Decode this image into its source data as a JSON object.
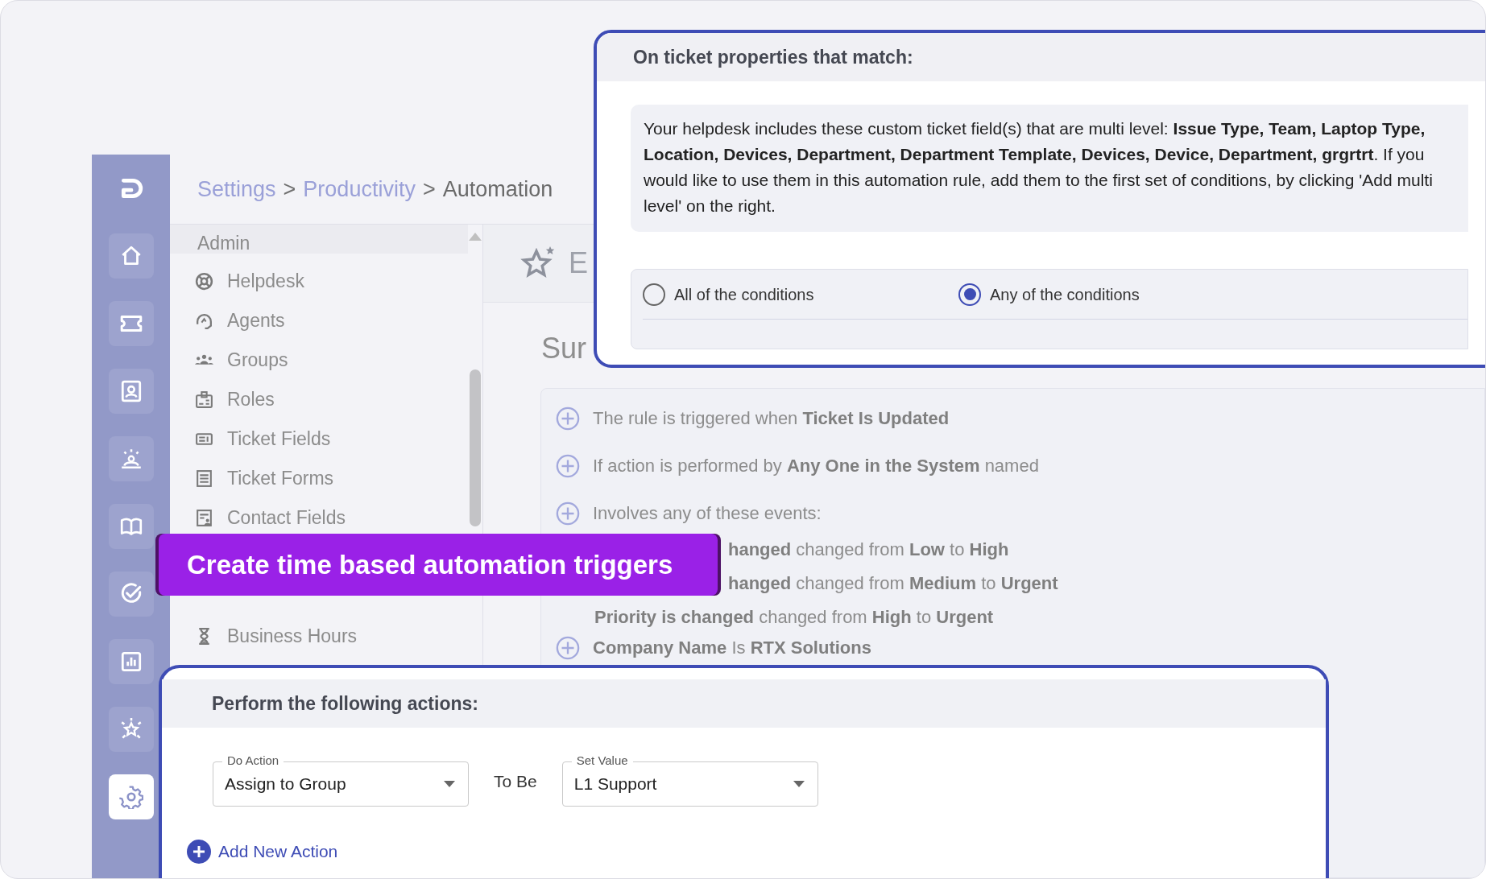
{
  "nav_rail": [
    {
      "selected": false
    },
    {
      "selected": false
    },
    {
      "selected": false
    },
    {
      "selected": false
    },
    {
      "selected": false
    },
    {
      "selected": false
    },
    {
      "selected": false
    },
    {
      "selected": false
    },
    {
      "selected": false
    },
    {
      "selected": true
    }
  ],
  "breadcrumb": [
    {
      "text": "Settings",
      "kind": "link"
    },
    {
      "text": ">",
      "kind": "separator"
    },
    {
      "text": "Productivity",
      "kind": "link"
    },
    {
      "text": ">",
      "kind": "separator"
    },
    {
      "text": "Automation",
      "kind": "current"
    }
  ],
  "admin_menu": {
    "heading": "Admin",
    "items": [
      {
        "label": "Helpdesk"
      },
      {
        "label": "Agents"
      },
      {
        "label": "Groups"
      },
      {
        "label": "Roles"
      },
      {
        "label": "Ticket Fields"
      },
      {
        "label": "Ticket Forms"
      },
      {
        "label": "Contact Fields"
      },
      {
        "label": "Business Hours"
      }
    ]
  },
  "page_header": {
    "title": "E"
  },
  "summary_heading": "Sur",
  "rules": [
    {
      "text": "The rule is triggered when  **Ticket Is Updated**"
    },
    {
      "text": "If action is performed by **Any One in the System** named"
    },
    {
      "text": "Involves any of these events:",
      "events": [
        {
          "text": "**hanged** changed from **Low** to **High**",
          "kind": "covered"
        },
        {
          "text": "**hanged** changed from **Medium** to **Urgent**",
          "kind": "covered"
        },
        {
          "text": "**Priority is changed** changed from **High** to **Urgent**",
          "kind": "full"
        }
      ]
    },
    {
      "text": "**Company Name** Is **RTX Solutions**"
    }
  ],
  "conditions_card": {
    "title": "On ticket properties that match:",
    "notice": "Your helpdesk includes these custom ticket field(s) that are multi level: **Issue Type, Team, Laptop Type, Location, Devices, Department, Department Template, Devices, Device, Department, grgrtrt**. If you would like to use them in this automation rule, add them to the first set of conditions, by clicking 'Add multi level' on the right.",
    "match_options": [
      {
        "label": "All of the conditions",
        "selected": false
      },
      {
        "label": "Any of the conditions",
        "selected": true
      }
    ]
  },
  "banner": {
    "text": "Create time based automation triggers"
  },
  "actions_card": {
    "title": "Perform the following actions:",
    "actions": [
      {
        "action_label": "Do Action",
        "action_value": "Assign to Group",
        "connector": "To Be",
        "value_label": "Set Value",
        "value": "L1 Support"
      }
    ],
    "add_button": "Add New Action"
  }
}
